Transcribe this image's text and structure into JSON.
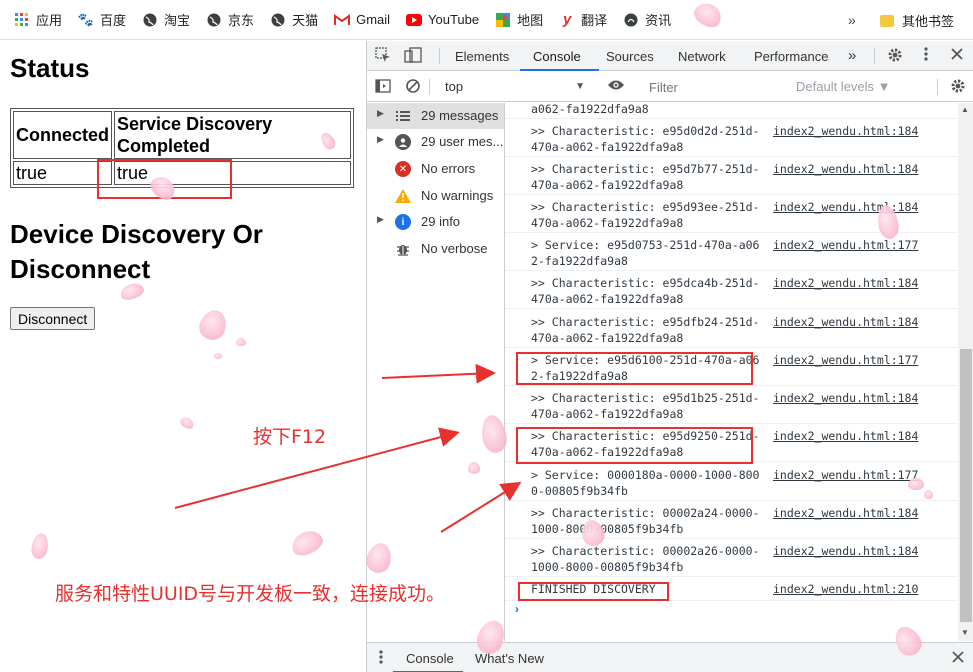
{
  "bookmarks": {
    "items": [
      {
        "label": "应用",
        "icon": "apps-grid-icon",
        "color": "#4285f4"
      },
      {
        "label": "百度",
        "icon": "baidu-paw-icon",
        "color": "#2932e1"
      },
      {
        "label": "淘宝",
        "icon": "globe-icon",
        "color": "#5f6368"
      },
      {
        "label": "京东",
        "icon": "globe-icon",
        "color": "#5f6368"
      },
      {
        "label": "天猫",
        "icon": "globe-icon",
        "color": "#5f6368"
      },
      {
        "label": "Gmail",
        "icon": "gmail-icon",
        "color": "#d93025"
      },
      {
        "label": "YouTube",
        "icon": "youtube-icon",
        "color": "#ff0000"
      },
      {
        "label": "地图",
        "icon": "maps-icon",
        "color": "#34a853"
      },
      {
        "label": "翻译",
        "icon": "youdao-y-icon",
        "color": "#e52e2e"
      },
      {
        "label": "资讯",
        "icon": "news-icon",
        "color": "#5f6368"
      }
    ],
    "more": "»",
    "other": "其他书签"
  },
  "page": {
    "status_title": "Status",
    "table": {
      "headers": [
        "Connected",
        "Service Discovery Completed"
      ],
      "row": [
        "true",
        "true"
      ]
    },
    "discovery_title": "Device Discovery Or Disconnect",
    "disconnect_label": "Disconnect"
  },
  "annotations": {
    "press_f12": "按下F12",
    "success": "服务和特性UUID号与开发板一致，连接成功。",
    "color": "#e8312f"
  },
  "devtools": {
    "tabs": [
      "Elements",
      "Console",
      "Sources",
      "Network",
      "Performance"
    ],
    "active_tab": "Console",
    "more_tabs": "»",
    "context": "top",
    "filter_placeholder": "Filter",
    "levels": "Default levels ▼",
    "sidebar": [
      {
        "label": "29 messages",
        "icon": "list-icon",
        "expandable": true,
        "selected": true
      },
      {
        "label": "29 user mes...",
        "icon": "user-icon",
        "expandable": true
      },
      {
        "label": "No errors",
        "icon": "error-icon",
        "expandable": false
      },
      {
        "label": "No warnings",
        "icon": "warning-icon",
        "expandable": false
      },
      {
        "label": "29 info",
        "icon": "info-icon",
        "expandable": true
      },
      {
        "label": "No verbose",
        "icon": "bug-icon",
        "expandable": false
      }
    ],
    "log": [
      {
        "msg": "a062-fa1922dfa9a8",
        "src": ""
      },
      {
        "msg": ">> Characteristic: e95d0d2d-251d-470a-a062-fa1922dfa9a8",
        "src": "index2_wendu.html:184"
      },
      {
        "msg": ">> Characteristic: e95d7b77-251d-470a-a062-fa1922dfa9a8",
        "src": "index2_wendu.html:184"
      },
      {
        "msg": ">> Characteristic: e95d93ee-251d-470a-a062-fa1922dfa9a8",
        "src": "index2_wendu.html:184"
      },
      {
        "msg": "> Service: e95d0753-251d-470a-a062-fa1922dfa9a8",
        "src": "index2_wendu.html:177"
      },
      {
        "msg": ">> Characteristic: e95dca4b-251d-470a-a062-fa1922dfa9a8",
        "src": "index2_wendu.html:184"
      },
      {
        "msg": ">> Characteristic: e95dfb24-251d-470a-a062-fa1922dfa9a8",
        "src": "index2_wendu.html:184"
      },
      {
        "msg": "> Service: e95d6100-251d-470a-a062-fa1922dfa9a8",
        "src": "index2_wendu.html:177"
      },
      {
        "msg": ">> Characteristic: e95d1b25-251d-470a-a062-fa1922dfa9a8",
        "src": "index2_wendu.html:184"
      },
      {
        "msg": ">> Characteristic: e95d9250-251d-470a-a062-fa1922dfa9a8",
        "src": "index2_wendu.html:184"
      },
      {
        "msg": "> Service: 0000180a-0000-1000-8000-00805f9b34fb",
        "src": "index2_wendu.html:177"
      },
      {
        "msg": ">> Characteristic: 00002a24-0000-1000-8000-00805f9b34fb",
        "src": "index2_wendu.html:184"
      },
      {
        "msg": ">> Characteristic: 00002a26-0000-1000-8000-00805f9b34fb",
        "src": "index2_wendu.html:184"
      },
      {
        "msg": "FINISHED DISCOVERY",
        "src": "index2_wendu.html:210"
      }
    ],
    "prompt": "›",
    "drawer_tabs": [
      "Console",
      "What's New"
    ]
  }
}
